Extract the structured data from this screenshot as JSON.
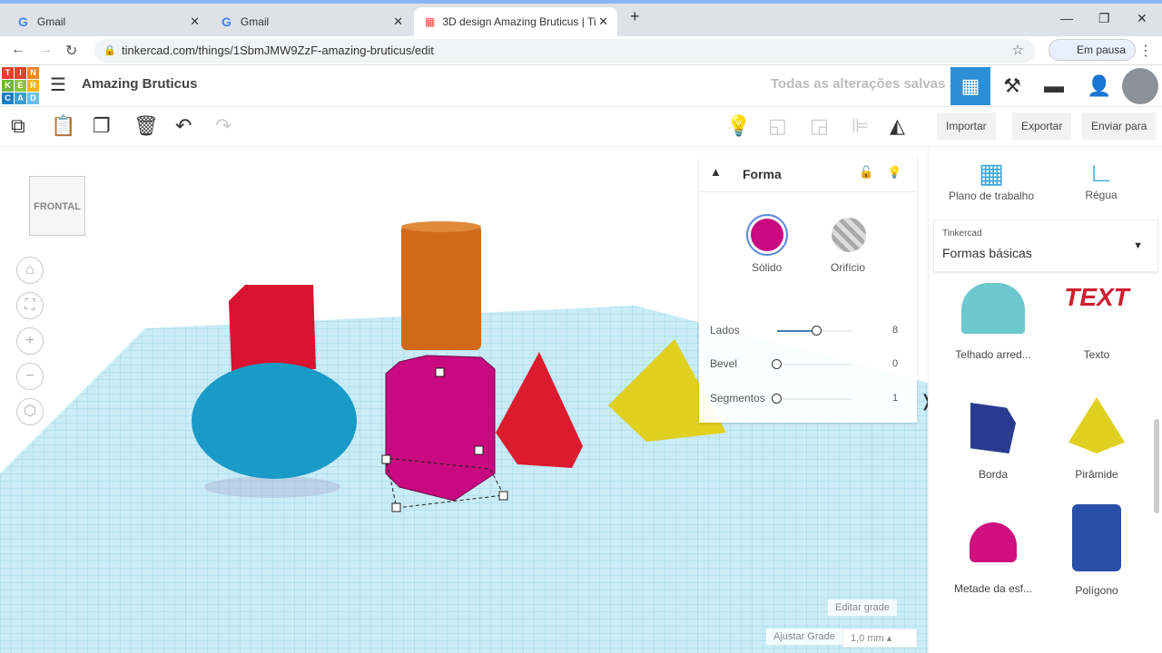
{
  "browser": {
    "tabs": [
      {
        "label": "Gmail"
      },
      {
        "label": "Gmail"
      },
      {
        "label": "3D design Amazing Bruticus | Tin"
      }
    ],
    "url": "tinkercad.com/things/1SbmJMW9ZzF-amazing-bruticus/edit",
    "profile": "Em pausa"
  },
  "header": {
    "logo": [
      "T",
      "I",
      "N",
      "K",
      "E",
      "R",
      "C",
      "A",
      "D"
    ],
    "title": "Amazing Bruticus",
    "status": "Todas as alterações salvas"
  },
  "toolbar": {
    "import": "Importar",
    "export": "Exportar",
    "send": "Enviar para"
  },
  "viewcube": "FRONTAL",
  "inspector": {
    "title": "Forma",
    "solid": "Sólido",
    "hole": "Orifício",
    "solid_color": "#c8097f",
    "params": [
      {
        "label": "Lados",
        "value": "8",
        "fraction": 0.5
      },
      {
        "label": "Bevel",
        "value": "0",
        "fraction": 0
      },
      {
        "label": "Segmentos",
        "value": "1",
        "fraction": 0
      }
    ]
  },
  "library": {
    "workplane": "Plano de trabalho",
    "ruler": "Régua",
    "source": "Tinkercad",
    "category": "Formas básicas",
    "shapes": [
      {
        "label": "Telhado arred..."
      },
      {
        "label": "Texto"
      },
      {
        "label": "Borda"
      },
      {
        "label": "Pirâmide"
      },
      {
        "label": "Metade da esf..."
      },
      {
        "label": "Polígono"
      }
    ]
  },
  "grid": {
    "edit": "Editar grade",
    "snap_label": "Ajustar Grade",
    "snap_value": "1,0 mm"
  }
}
